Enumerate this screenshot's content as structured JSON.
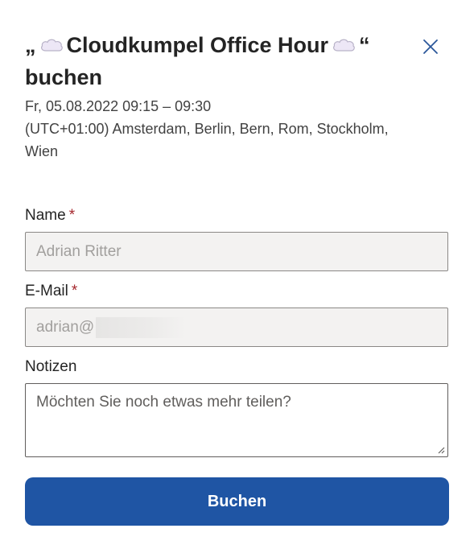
{
  "dialog": {
    "title_open_quote": "„",
    "title_text": "Cloudkumpel Office Hour",
    "title_close_quote": "“",
    "title_suffix": "buchen",
    "title_icon": "cloud-icon",
    "close_icon": "close-icon",
    "date_time": "Fr, 05.08.2022 09:15 – 09:30",
    "timezone": "(UTC+01:00) Amsterdam, Berlin, Bern, Rom, Stockholm, Wien"
  },
  "form": {
    "name": {
      "label": "Name",
      "required_mark": "*",
      "value": "Adrian Ritter"
    },
    "email": {
      "label": "E-Mail",
      "required_mark": "*",
      "value_visible": "adrian@"
    },
    "notes": {
      "label": "Notizen",
      "placeholder": "Möchten Sie noch etwas mehr teilen?"
    },
    "submit_label": "Buchen"
  },
  "colors": {
    "primary_button": "#1f55a4",
    "required_asterisk": "#a4262c",
    "close_icon": "#2b579a",
    "disabled_input_bg": "#f3f2f1",
    "cloud_fill": "#ede7f6"
  }
}
